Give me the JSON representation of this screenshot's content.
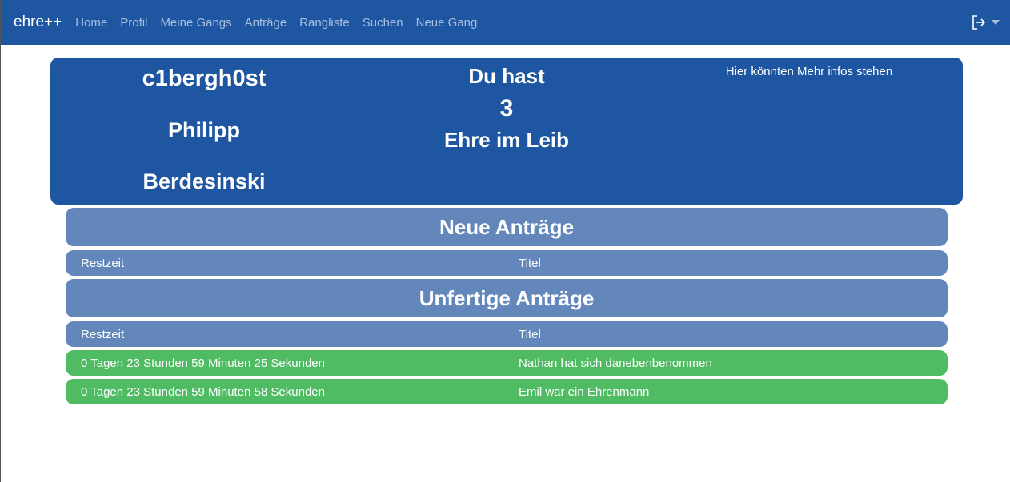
{
  "navbar": {
    "brand": "ehre++",
    "links": [
      "Home",
      "Profil",
      "Meine Gangs",
      "Anträge",
      "Rangliste",
      "Suchen",
      "Neue Gang"
    ],
    "logout_icon": "logout-icon"
  },
  "profile": {
    "username": "c1bergh0st",
    "first_name": "Philipp",
    "last_name": "Berdesinski",
    "ehre_line1": "Du hast",
    "ehre_count": "3",
    "ehre_line3": "Ehre im Leib",
    "info": "Hier könnten Mehr infos stehen"
  },
  "new_requests": {
    "title": "Neue Anträge",
    "columns": [
      "Restzeit",
      "Titel"
    ],
    "rows": []
  },
  "open_requests": {
    "title": "Unfertige Anträge",
    "columns": [
      "Restzeit",
      "Titel"
    ],
    "rows": [
      [
        "0 Tagen 23 Stunden 59 Minuten 25 Sekunden",
        "Nathan hat sich danebenbenommen"
      ],
      [
        "0 Tagen 23 Stunden 59 Minuten 58 Sekunden",
        "Emil war ein Ehrenmann"
      ]
    ]
  },
  "colors": {
    "primary": "#1f56a2",
    "section": "#6487bb",
    "success": "#4fbb62"
  }
}
